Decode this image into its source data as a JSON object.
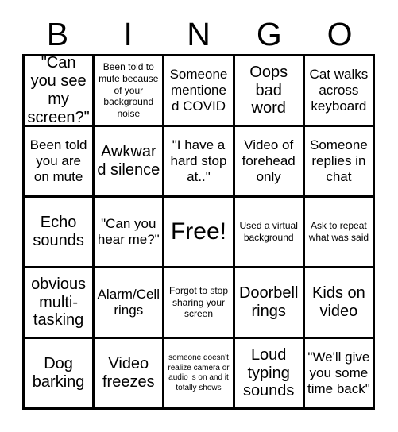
{
  "card": {
    "title_letters": [
      "B",
      "I",
      "N",
      "G",
      "O"
    ],
    "columns": 5,
    "rows": 5,
    "free_space_index": 12,
    "colors": {
      "background": "#ffffff",
      "border": "#000000",
      "text": "#000000"
    },
    "cells": [
      {
        "text": "\"Can you see my screen?\"",
        "size": "lg"
      },
      {
        "text": "Been told to mute because of your background noise",
        "size": "sm"
      },
      {
        "text": "Someone mentioned COVID",
        "size": "md"
      },
      {
        "text": "Oops bad word",
        "size": "lg"
      },
      {
        "text": "Cat walks across keyboard",
        "size": "md"
      },
      {
        "text": "Been told you are on mute",
        "size": "md"
      },
      {
        "text": "Awkward silence",
        "size": "lg"
      },
      {
        "text": "\"I have a hard stop at..\"",
        "size": "md"
      },
      {
        "text": "Video of forehead only",
        "size": "md"
      },
      {
        "text": "Someone replies in chat",
        "size": "md"
      },
      {
        "text": "Echo sounds",
        "size": "lg"
      },
      {
        "text": "\"Can you hear me?\"",
        "size": "md"
      },
      {
        "text": "Free!",
        "size": "xl"
      },
      {
        "text": "Used a virtual background",
        "size": "sm"
      },
      {
        "text": "Ask to repeat what was said",
        "size": "sm"
      },
      {
        "text": "obvious multi-tasking",
        "size": "lg"
      },
      {
        "text": "Alarm/Cell rings",
        "size": "md"
      },
      {
        "text": "Forgot to stop sharing your screen",
        "size": "sm"
      },
      {
        "text": "Doorbell rings",
        "size": "lg"
      },
      {
        "text": "Kids on video",
        "size": "lg"
      },
      {
        "text": "Dog barking",
        "size": "lg"
      },
      {
        "text": "Video freezes",
        "size": "lg"
      },
      {
        "text": "someone doesn't realize camera or audio is on and it totally shows",
        "size": "xs"
      },
      {
        "text": "Loud typing sounds",
        "size": "lg"
      },
      {
        "text": "\"We'll give you some time back\"",
        "size": "md"
      }
    ]
  }
}
